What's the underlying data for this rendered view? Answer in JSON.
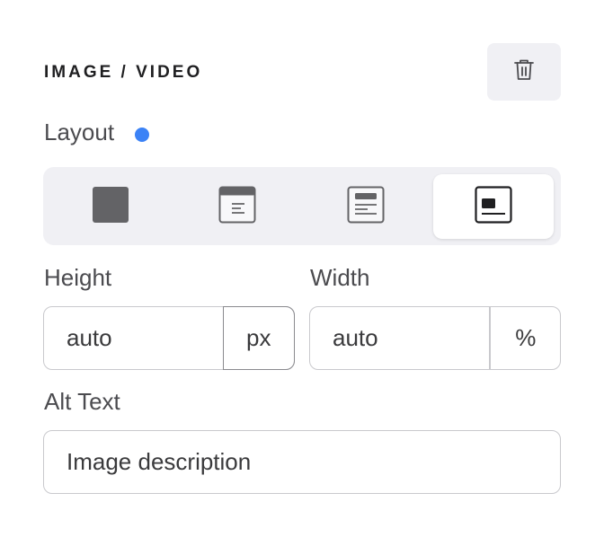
{
  "panel": {
    "title": "IMAGE / VIDEO",
    "delete_icon": "trash-icon"
  },
  "layout": {
    "label": "Layout",
    "indicator_color": "#3b82f6",
    "options": [
      {
        "icon": "layout-full-icon",
        "active": false
      },
      {
        "icon": "layout-top-icon",
        "active": false
      },
      {
        "icon": "layout-inset-icon",
        "active": false
      },
      {
        "icon": "layout-left-icon",
        "active": true
      }
    ]
  },
  "height": {
    "label": "Height",
    "value": "auto",
    "unit": "px"
  },
  "width": {
    "label": "Width",
    "value": "auto",
    "unit": "%"
  },
  "alt_text": {
    "label": "Alt Text",
    "value": "Image description"
  }
}
